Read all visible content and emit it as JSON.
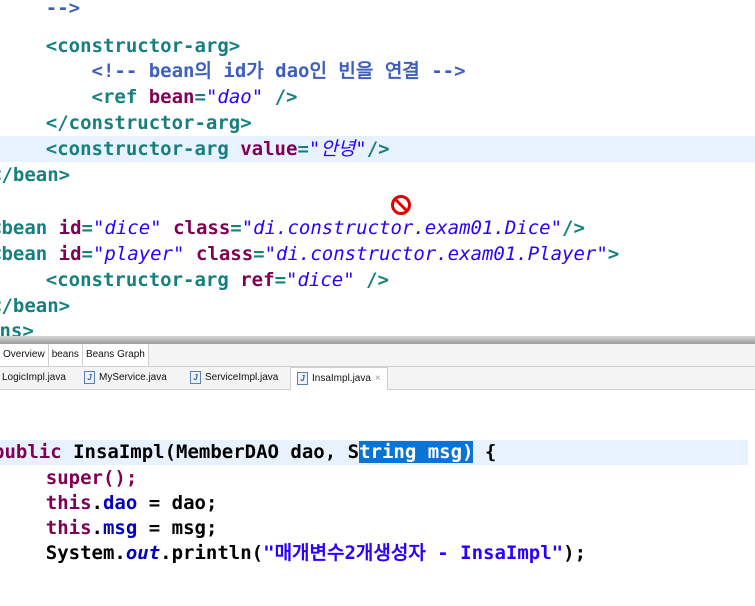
{
  "xml": {
    "line1_close_comment": "-->",
    "line2": "<constructor-arg>",
    "line3_comment": "<!-- bean의 id가 dao인 빈을 연결 -->",
    "line4": {
      "open": "<ref ",
      "attr": "bean",
      "eq": "=",
      "val": "\"dao\"",
      "close": " />"
    },
    "line5": "</constructor-arg>",
    "line6": {
      "open": "<constructor-arg ",
      "attr": "value",
      "eq": "=",
      "val": "\"안녕\"",
      "close": "/>"
    },
    "line7": "</bean>",
    "line8": {
      "open": "<bean ",
      "attr1": "id",
      "eq1": "=",
      "val1": "\"dice\"",
      "sp": " ",
      "attr2": "class",
      "eq2": "=",
      "val2": "\"di.constructor.exam01.Dice\"",
      "close": "/>"
    },
    "line9": {
      "open": "<bean ",
      "attr1": "id",
      "eq1": "=",
      "val1": "\"player\"",
      "sp": " ",
      "attr2": "class",
      "eq2": "=",
      "val2": "\"di.constructor.exam01.Player\"",
      "close": ">"
    },
    "line10": {
      "open": "<constructor-arg ",
      "attr": "ref",
      "eq": "=",
      "val": "\"dice\"",
      "close": " />"
    },
    "line11": "</bean>",
    "line12": "ans>"
  },
  "editor_tabs": {
    "overview": "Overview",
    "beans": "beans",
    "beans_graph": "Beans Graph"
  },
  "file_tabs": [
    {
      "label": "LogicImpl.java"
    },
    {
      "label": "MyService.java"
    },
    {
      "label": "ServiceImpl.java"
    },
    {
      "label": "InsaImpl.java",
      "active": true
    }
  ],
  "close_glyph": "×",
  "java": {
    "sig": {
      "kw": "public",
      "sp1": " ",
      "name": "InsaImpl(MemberDAO dao, S",
      "sel": "tring msg)",
      "rest": " {"
    },
    "super": "super();",
    "this1": {
      "kw": "this",
      "dot": ".",
      "field": "dao",
      "rest": " = dao;"
    },
    "this2": {
      "kw": "this",
      "dot": ".",
      "field": "msg",
      "rest": " = msg;"
    },
    "print": {
      "pre": "System.",
      "out": "out",
      "mid": ".println(",
      "str": "\"매개변수2개생성자 - InsaImpl\"",
      "end": ");"
    }
  },
  "colors": {
    "tag": "#17807e",
    "attr": "#7f0055",
    "value": "#2a00ff",
    "highlight": "#e8f2fe",
    "selection": "#0a74d6"
  }
}
